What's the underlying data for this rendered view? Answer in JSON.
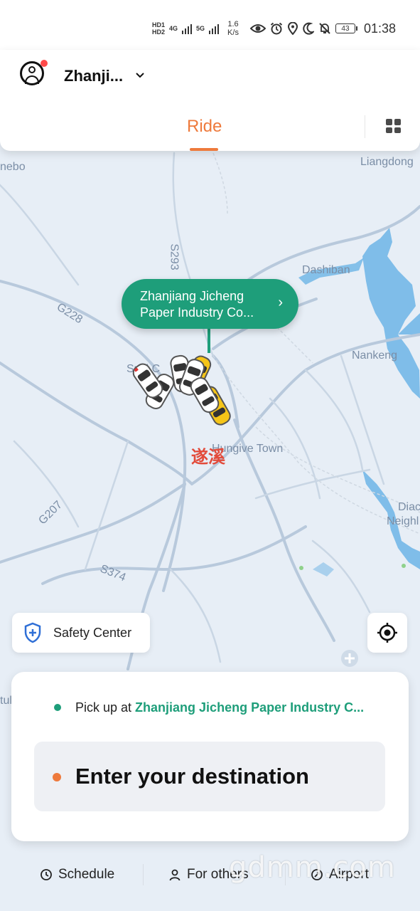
{
  "status_bar": {
    "hd1": "HD1",
    "hd2": "HD2",
    "net1": "4G",
    "net2": "5G",
    "speed_value": "1.6",
    "speed_unit": "K/s",
    "battery": "43",
    "time": "01:38"
  },
  "header": {
    "city": "Zhanji...",
    "tab_ride": "Ride"
  },
  "map": {
    "labels": {
      "nehebo": "nebo",
      "liangdong": "Liangdong",
      "dashiban": "Dashiban",
      "nankeng": "Nankeng",
      "g228": "G228",
      "s293": "S293",
      "g207": "G207",
      "s374": "S374",
      "town": "Hungive Town",
      "diac": "Diac",
      "neigh": "Neighl",
      "suixi_partial": "Suxi C",
      "tul": "tul"
    },
    "city_cn": "遂溪"
  },
  "pickup_bubble": {
    "line1": "Zhanjiang Jicheng",
    "line2": "Paper Industry Co..."
  },
  "safety_center": {
    "label": "Safety Center"
  },
  "trip_card": {
    "pickup_prefix": "Pick up at ",
    "pickup_place": "Zhanjiang Jicheng Paper Industry C...",
    "destination_placeholder": "Enter your destination"
  },
  "bottom_nav": {
    "schedule": "Schedule",
    "for_others": "For others",
    "airport": "Airport"
  },
  "watermark": "gdmm.com",
  "colors": {
    "accent_orange": "#ee7a3c",
    "brand_green": "#1e9e7a",
    "notification_red": "#ff4a4a",
    "map_water": "#6cb4e6"
  }
}
